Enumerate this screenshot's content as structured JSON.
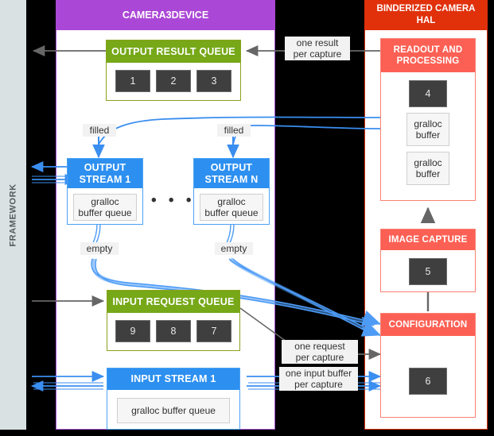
{
  "framework": {
    "label": "FRAMEWORK"
  },
  "panels": {
    "camera3device": {
      "title": "CAMERA3DEVICE",
      "color": "#ab47d6"
    },
    "hal": {
      "title": "BINDERIZED CAMERA HAL",
      "color": "#e0310b"
    }
  },
  "output_result_queue": {
    "title": "OUTPUT RESULT QUEUE",
    "chips": [
      "1",
      "2",
      "3"
    ],
    "color": "#76a818"
  },
  "input_request_queue": {
    "title": "INPUT REQUEST QUEUE",
    "chips": [
      "9",
      "8",
      "7"
    ],
    "color": "#76a818"
  },
  "output_streams": [
    {
      "title": "OUTPUT\nSTREAM 1",
      "inner": "gralloc\nbuffer queue",
      "filled_label": "filled",
      "empty_label": "empty"
    },
    {
      "title": "OUTPUT\nSTREAM N",
      "inner": "gralloc\nbuffer queue",
      "filled_label": "filled",
      "empty_label": "empty"
    }
  ],
  "stream_separator": "• • •",
  "input_stream": {
    "title": "INPUT STREAM 1",
    "inner": "gralloc buffer queue",
    "color": "#2d90f0"
  },
  "hal_blocks": [
    {
      "title": "READOUT AND PROCESSING",
      "chip": "4",
      "buffers": [
        "gralloc\nbuffer",
        "gralloc\nbuffer"
      ]
    },
    {
      "title": "IMAGE CAPTURE",
      "chip": "5",
      "buffers": []
    },
    {
      "title": "CONFIGURATION",
      "chip": "6",
      "buffers": []
    }
  ],
  "edge_labels": {
    "one_result_per_capture": "one result\nper capture",
    "one_request_per_capture": "one request\nper capture",
    "one_input_buffer_per_capture": "one input buffer\nper capture"
  },
  "colors": {
    "framework_band": "#dae1e3",
    "purple": "#ab47d6",
    "red": "#e0310b",
    "salmon": "#fc6054",
    "green": "#76a818",
    "blue": "#2d90f0",
    "chip": "#3f3f3f",
    "gray_arrow": "#666666",
    "blue_arrow": "#3a8ef0"
  }
}
